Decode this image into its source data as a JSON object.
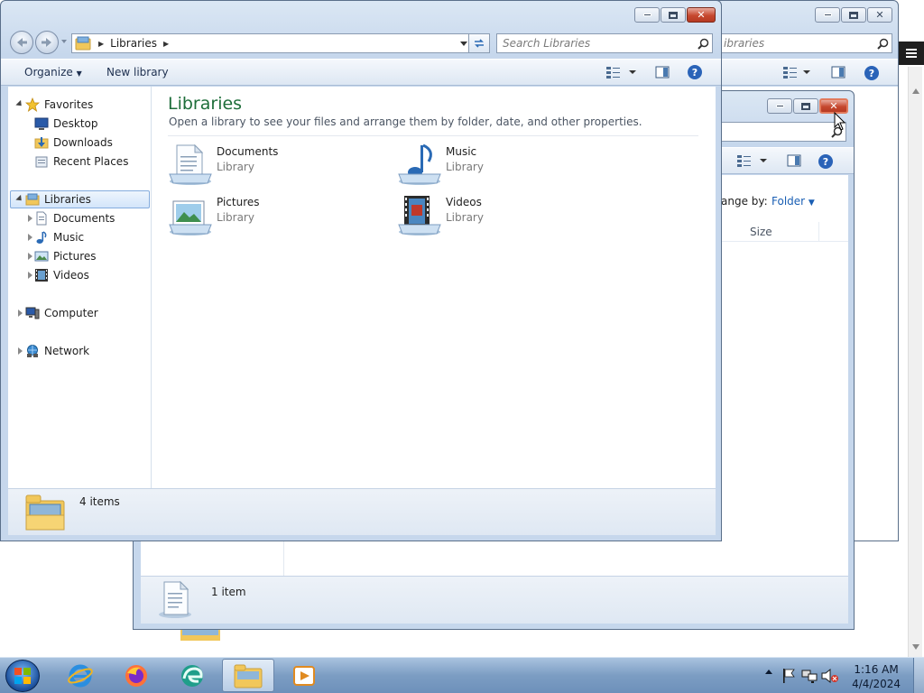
{
  "back_window_3": {
    "search_fragment": "ibraries"
  },
  "back_window_2": {
    "arrange_label": "ange by:",
    "arrange_value": "Folder",
    "size_header": "Size",
    "status_text": "1 item"
  },
  "front_window": {
    "address": {
      "crumb": "Libraries"
    },
    "search": {
      "placeholder": "Search Libraries"
    },
    "cmd": {
      "organize": "Organize",
      "new_library": "New library"
    },
    "tree": {
      "favorites": "Favorites",
      "desktop": "Desktop",
      "downloads": "Downloads",
      "recent": "Recent Places",
      "libraries": "Libraries",
      "documents": "Documents",
      "music": "Music",
      "pictures": "Pictures",
      "videos": "Videos",
      "computer": "Computer",
      "network": "Network"
    },
    "main": {
      "title": "Libraries",
      "subtitle": "Open a library to see your files and arrange them by folder, date, and other properties.",
      "items": [
        {
          "name": "Documents",
          "type": "Library"
        },
        {
          "name": "Music",
          "type": "Library"
        },
        {
          "name": "Pictures",
          "type": "Library"
        },
        {
          "name": "Videos",
          "type": "Library"
        }
      ]
    },
    "status": {
      "count": "4 items"
    }
  },
  "taskbar": {
    "clock": {
      "time": "1:16 AM",
      "date": "4/4/2024"
    }
  }
}
